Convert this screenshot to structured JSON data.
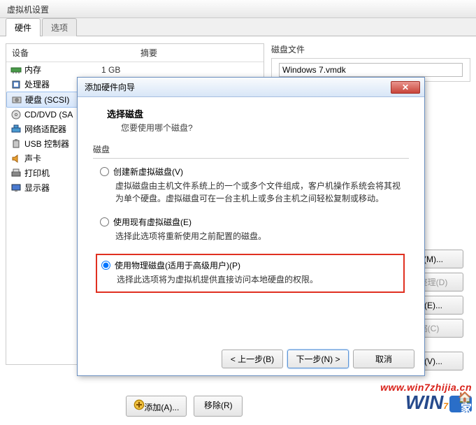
{
  "window": {
    "title": "虚拟机设置"
  },
  "tabs": {
    "hw": "硬件",
    "opt": "选项"
  },
  "lp": {
    "h_device": "设备",
    "h_summary": "摘要",
    "rows": [
      {
        "name": "内存",
        "summary": "1 GB"
      },
      {
        "name": "处理器",
        "summary": ""
      },
      {
        "name": "硬盘 (SCSI)",
        "summary": ""
      },
      {
        "name": "CD/DVD (SA",
        "summary": ""
      },
      {
        "name": "网络适配器",
        "summary": ""
      },
      {
        "name": "USB 控制器",
        "summary": ""
      },
      {
        "name": "声卡",
        "summary": ""
      },
      {
        "name": "打印机",
        "summary": ""
      },
      {
        "name": "显示器",
        "summary": ""
      }
    ]
  },
  "right": {
    "disk_file_label": "磁盘文件",
    "disk_file_value": "Windows 7.vmdk",
    "btn_map": "映射(M)...",
    "btn_defrag": "碎片整理(D)",
    "btn_expand": "扩展(E)...",
    "btn_compress": "压缩(C)",
    "btn_advanced": "高级(V)..."
  },
  "bottom": {
    "add": "添加(A)...",
    "remove": "移除(R)"
  },
  "dialog": {
    "title": "添加硬件向导",
    "heading": "选择磁盘",
    "sub": "您要使用哪个磁盘?",
    "group": "磁盘",
    "r1_label": "创建新虚拟磁盘(V)",
    "r1_desc": "虚拟磁盘由主机文件系统上的一个或多个文件组成，客户机操作系统会将其视为单个硬盘。虚拟磁盘可在一台主机上或多台主机之间轻松复制或移动。",
    "r2_label": "使用现有虚拟磁盘(E)",
    "r2_desc": "选择此选项将重新使用之前配置的磁盘。",
    "r3_label": "使用物理磁盘(适用于高级用户)(P)",
    "r3_desc": "选择此选项将为虚拟机提供直接访问本地硬盘的权限。",
    "btn_back": "< 上一步(B)",
    "btn_next": "下一步(N) >",
    "btn_cancel": "取消"
  },
  "watermark": {
    "url": "www.win7zhijia.cn"
  }
}
